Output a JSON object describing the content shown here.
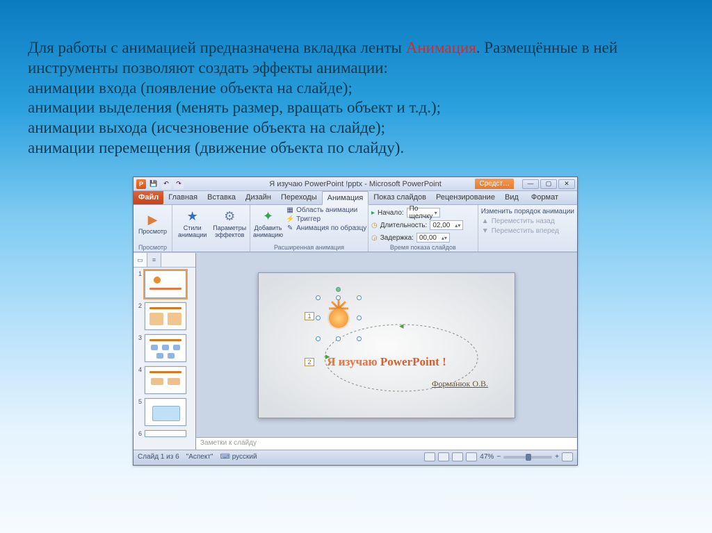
{
  "intro": {
    "line1a": "Для работы с анимацией предназначена вкладка ленты ",
    "line1b": "Анимация",
    "line1c": ". Размещённые в ней инструменты позволяют создать  эффекты анимации:",
    "line2": "анимации входа (появление объекта на слайде);",
    "line3": "анимации выделения (менять размер, вращать объект и т.д.);",
    "line4": "анимации выхода (исчезновение объекта на слайде);",
    "line5": "анимации перемещения (движение объекта по слайду)."
  },
  "window": {
    "title": "Я изучаю PowerPoint !pptx  -  Microsoft PowerPoint",
    "contextual": "Средст…"
  },
  "tabs": {
    "file": "Файл",
    "home": "Главная",
    "insert": "Вставка",
    "design": "Дизайн",
    "transitions": "Переходы",
    "animation": "Анимация",
    "slideshow": "Показ слайдов",
    "review": "Рецензирование",
    "view": "Вид",
    "format": "Формат"
  },
  "ribbon": {
    "preview": {
      "btn": "Просмотр",
      "group": "Просмотр"
    },
    "anim": {
      "styles": "Стили\nанимации",
      "params": "Параметры\nэффектов"
    },
    "adv": {
      "add": "Добавить\nанимацию",
      "pane": "Область анимации",
      "trigger": "Триггер",
      "painter": "Анимация по образцу",
      "group": "Расширенная анимация"
    },
    "timing": {
      "start_lbl": "Начало:",
      "start_val": "По щелчку",
      "duration_lbl": "Длительность:",
      "duration_val": "02,00",
      "delay_lbl": "Задержка:",
      "delay_val": "00,00",
      "group": "Время показа слайдов"
    },
    "reorder": {
      "title": "Изменить порядок анимации",
      "back": "Переместить назад",
      "fwd": "Переместить вперед"
    }
  },
  "slide": {
    "seq1": "1",
    "seq2": "2",
    "title_a": "Я изучаю ",
    "title_b": "PowerPoint !",
    "author": "Форманюк О.В."
  },
  "notes": "Заметки к слайду",
  "status": {
    "slide": "Слайд 1 из 6",
    "theme": "\"Аспект\"",
    "lang": "русский",
    "zoom": "47%"
  },
  "thumbs": [
    "1",
    "2",
    "3",
    "4",
    "5",
    "6"
  ]
}
